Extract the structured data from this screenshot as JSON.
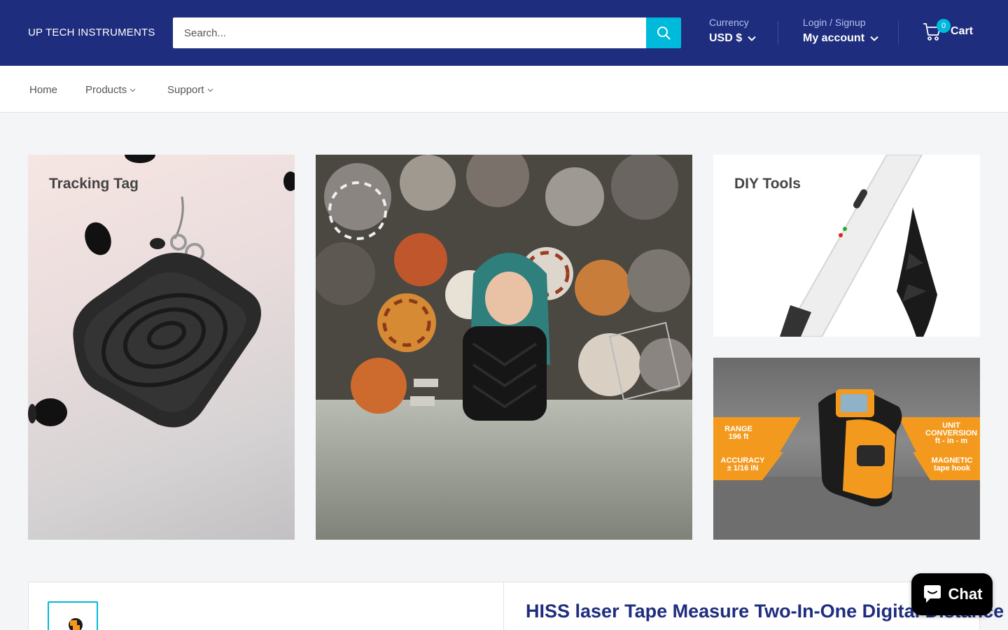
{
  "header": {
    "logo": "UP TECH INSTRUMENTS",
    "search_placeholder": "Search...",
    "currency_label": "Currency",
    "currency_value": "USD $",
    "login_label": "Login / Signup",
    "account_label": "My account",
    "cart_count": "0",
    "cart_label": "Cart"
  },
  "nav": {
    "items": [
      {
        "label": "Home"
      },
      {
        "label": "Products"
      },
      {
        "label": "Support"
      }
    ]
  },
  "promos": {
    "tracking_tag": "Tracking Tag",
    "diy_tools": "DIY Tools",
    "tape_labels": {
      "range": "RANGE\n196 ft",
      "accuracy": "ACCURACY\n± 1/16 IN",
      "unit": "UNIT\nCONVERSION\nft - in - m",
      "magnetic": "MAGNETIC\ntape hook"
    }
  },
  "product": {
    "title": "HISS laser Tape Measure Two-In-One Digital Distance"
  },
  "chat": {
    "label": "Chat"
  },
  "colors": {
    "header_bg": "#1e2d7d",
    "accent": "#00badb"
  }
}
